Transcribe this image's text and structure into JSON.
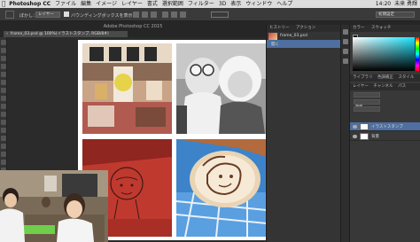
{
  "menubar": {
    "app_name": "Photoshop CC",
    "items": [
      "ファイル",
      "編集",
      "イメージ",
      "レイヤー",
      "書式",
      "選択範囲",
      "フィルター",
      "3D",
      "表示",
      "ウィンドウ",
      "ヘルプ"
    ],
    "time": "14:20",
    "user": "未来 勇輝"
  },
  "options_bar": {
    "label": "ぼかし：",
    "select_value": "レイヤー",
    "checkbox_label": "バウンディングボックスを表示",
    "workspace": "初期設定"
  },
  "window_title": "Adobe Photoshop CC 2015",
  "document_tab": "frame_03.psd @ 100%(イラストスタンプ, RGB/8#)",
  "history_panel": {
    "tabs": [
      "ヒストリー",
      "アクション"
    ],
    "items": [
      "frame_03.psd",
      "開く"
    ]
  },
  "color_panel": {
    "tabs": [
      "カラー",
      "スウォッチ"
    ],
    "accent_color": "#19e6ff"
  },
  "adjust_tabs": [
    "ライブラリ",
    "色調補正",
    "スタイル"
  ],
  "layers_panel": {
    "tabs": [
      "レイヤー",
      "チャンネル",
      "パス"
    ],
    "kind_label": "種類",
    "layers": [
      {
        "name": "イラストスタンプ",
        "selected": true
      },
      {
        "name": "背景",
        "selected": false
      }
    ]
  }
}
